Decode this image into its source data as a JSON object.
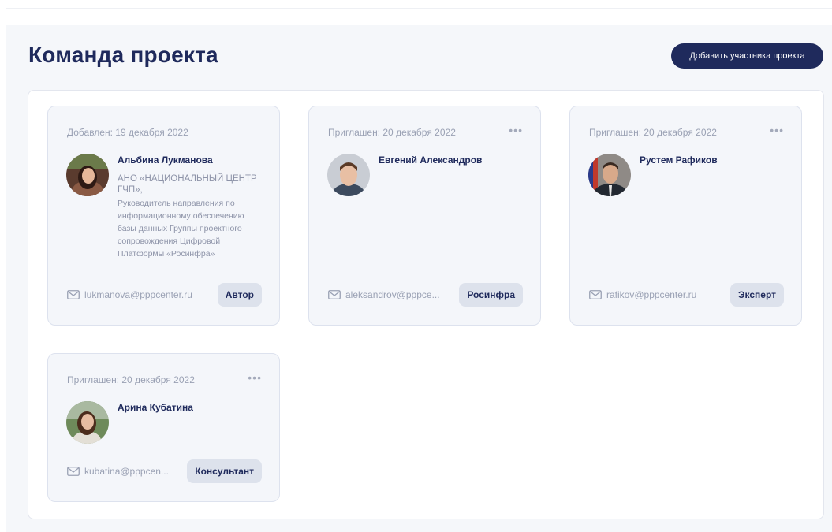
{
  "header": {
    "title": "Команда проекта",
    "add_member_label": "Добавить участника проекта"
  },
  "colors": {
    "accent": "#1f2a5c",
    "panel_bg": "#f5f7fa",
    "card_bg": "#f4f6fa",
    "badge_bg": "#dde2ec",
    "muted_text": "#9aa1b4"
  },
  "members": [
    {
      "date": "Добавлен: 19 декабря 2022",
      "name": "Альбина Лукманова",
      "organization": "АНО «НАЦИОНАЛЬНЫЙ ЦЕНТР ГЧП»,",
      "position": "Руководитель направления по информационному обеспечению базы данных Группы проектного сопровождения Цифровой Платформы «Росинфра»",
      "email": "lukmanova@pppcenter.ru",
      "role": "Автор",
      "has_menu": false,
      "avatar_icon": "user-photo"
    },
    {
      "date": "Приглашен: 20 декабря 2022",
      "name": "Евгений Александров",
      "email": "aleksandrov@pppce...",
      "role": "Росинфра",
      "has_menu": true,
      "menu_icon": "more-dots-icon",
      "avatar_icon": "user-photo"
    },
    {
      "date": "Приглашен: 20 декабря 2022",
      "name": "Рустем Рафиков",
      "email": "rafikov@pppcenter.ru",
      "role": "Эксперт",
      "has_menu": true,
      "menu_icon": "more-dots-icon",
      "avatar_icon": "user-photo"
    },
    {
      "date": "Приглашен: 20 декабря 2022",
      "name": "Арина Кубатина",
      "email": "kubatina@pppcen...",
      "role": "Консультант",
      "has_menu": true,
      "menu_icon": "more-dots-icon",
      "avatar_icon": "user-photo"
    }
  ],
  "icons": {
    "mail": "mail-icon",
    "menu": "more-dots-icon"
  }
}
